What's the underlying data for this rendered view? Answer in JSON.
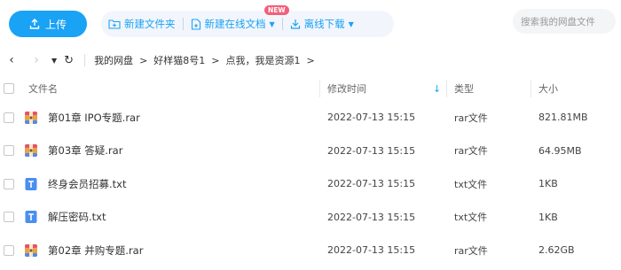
{
  "toolbar": {
    "upload_label": "上传",
    "new_folder_label": "新建文件夹",
    "new_online_doc_label": "新建在线文档",
    "new_badge": "NEW",
    "offline_download_label": "离线下载",
    "search_placeholder": "搜索我的网盘文件"
  },
  "breadcrumb": {
    "items": [
      "我的网盘",
      "好样猫8号1",
      "点我，我是资源1"
    ],
    "separator": ">"
  },
  "table": {
    "columns": {
      "name": "文件名",
      "modified": "修改时间",
      "type": "类型",
      "size": "大小"
    },
    "sort_indicator": "↓",
    "rows": [
      {
        "name": "第01章 IPO专题.rar",
        "modified": "2022-07-13 15:15",
        "type": "rar文件",
        "size": "821.81MB",
        "icon": "rar-icon"
      },
      {
        "name": "第03章 答疑.rar",
        "modified": "2022-07-13 15:15",
        "type": "rar文件",
        "size": "64.95MB",
        "icon": "rar-icon"
      },
      {
        "name": "终身会员招募.txt",
        "modified": "2022-07-13 15:15",
        "type": "txt文件",
        "size": "1KB",
        "icon": "txt-icon"
      },
      {
        "name": "解压密码.txt",
        "modified": "2022-07-13 15:15",
        "type": "txt文件",
        "size": "1KB",
        "icon": "txt-icon"
      },
      {
        "name": "第02章 并购专题.rar",
        "modified": "2022-07-13 15:15",
        "type": "rar文件",
        "size": "2.62GB",
        "icon": "rar-icon"
      }
    ]
  },
  "colors": {
    "accent": "#1aa2f5",
    "badge": "#f25f7a",
    "toolbar_bg": "#f2f6fc"
  }
}
